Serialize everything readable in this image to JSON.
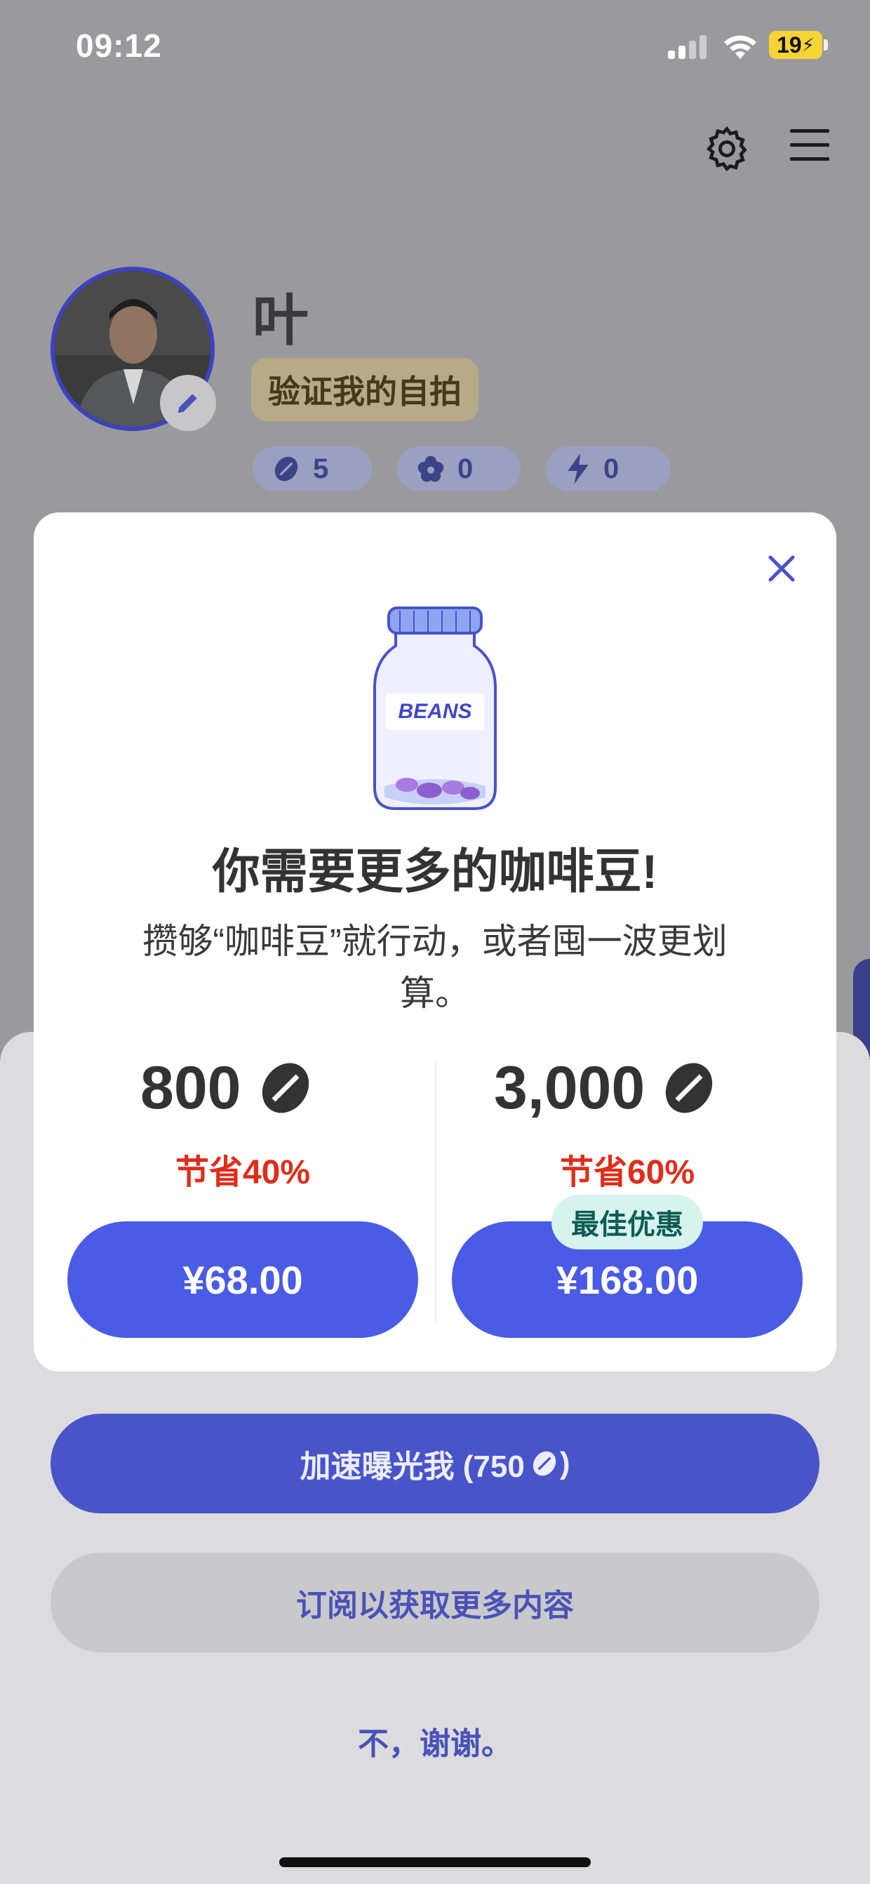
{
  "status_bar": {
    "time": "09:12",
    "battery": "19"
  },
  "profile": {
    "name": "叶",
    "verify_label": "验证我的自拍",
    "stats": [
      {
        "icon": "coffee-bean-icon",
        "value": "5"
      },
      {
        "icon": "flower-icon",
        "value": "0"
      },
      {
        "icon": "lightning-icon",
        "value": "0"
      }
    ]
  },
  "modal": {
    "jar_label": "BEANS",
    "title": "你需要更多的咖啡豆!",
    "subtitle": "攒够“咖啡豆”就行动，或者囤一波更划算。",
    "packages": [
      {
        "amount": "800",
        "save": "节省40%",
        "price": "¥68.00"
      },
      {
        "amount": "3,000",
        "save": "节省60%",
        "price": "¥168.00",
        "badge": "最佳优惠"
      }
    ]
  },
  "sheet": {
    "boost_label": "加速曝光我 (750",
    "boost_suffix": ")",
    "subscribe_label": "订阅以获取更多内容",
    "decline_label": "不，谢谢。"
  },
  "colors": {
    "primary": "#4a5be6",
    "save_red": "#e02d1a",
    "best_badge_bg": "#d7f3ee"
  }
}
